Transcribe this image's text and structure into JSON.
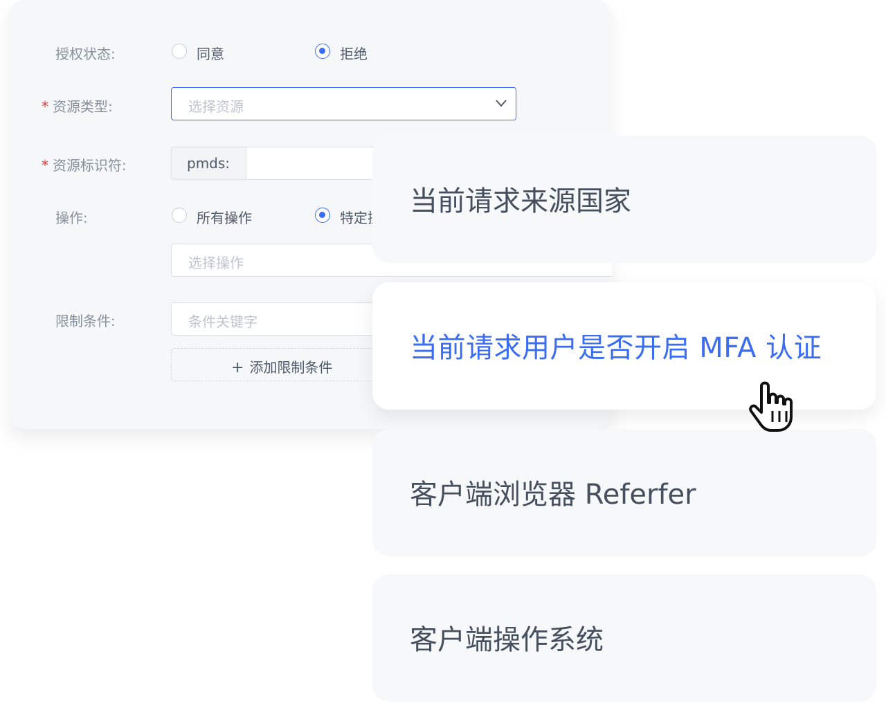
{
  "form": {
    "auth_status": {
      "label": "授权状态:",
      "options": [
        {
          "label": "同意",
          "checked": false
        },
        {
          "label": "拒绝",
          "checked": true
        }
      ]
    },
    "resource_type": {
      "required_mark": "*",
      "label": "资源类型:",
      "placeholder": "选择资源"
    },
    "resource_id": {
      "required_mark": "*",
      "label": "资源标识符:",
      "prefix": "pmds:"
    },
    "operation": {
      "label": "操作:",
      "options": [
        {
          "label": "所有操作",
          "checked": false
        },
        {
          "label": "特定操作",
          "checked": true
        }
      ],
      "placeholder": "选择操作"
    },
    "conditions": {
      "label": "限制条件:",
      "placeholder": "条件关键字",
      "add_label": "添加限制条件"
    }
  },
  "condition_options": [
    {
      "label": "当前请求来源国家",
      "active": false
    },
    {
      "label": "当前请求用户是否开启 MFA 认证",
      "active": true
    },
    {
      "label": "客户端浏览器 Referfer",
      "active": false
    },
    {
      "label": "客户端操作系统",
      "active": false
    }
  ],
  "colors": {
    "accent": "#3a6cf4",
    "required": "#e03a3a",
    "panel_bg": "#f6f7f9"
  },
  "icons": [
    "chevron-down-icon",
    "plus-icon",
    "hand-pointer-cursor-icon"
  ]
}
